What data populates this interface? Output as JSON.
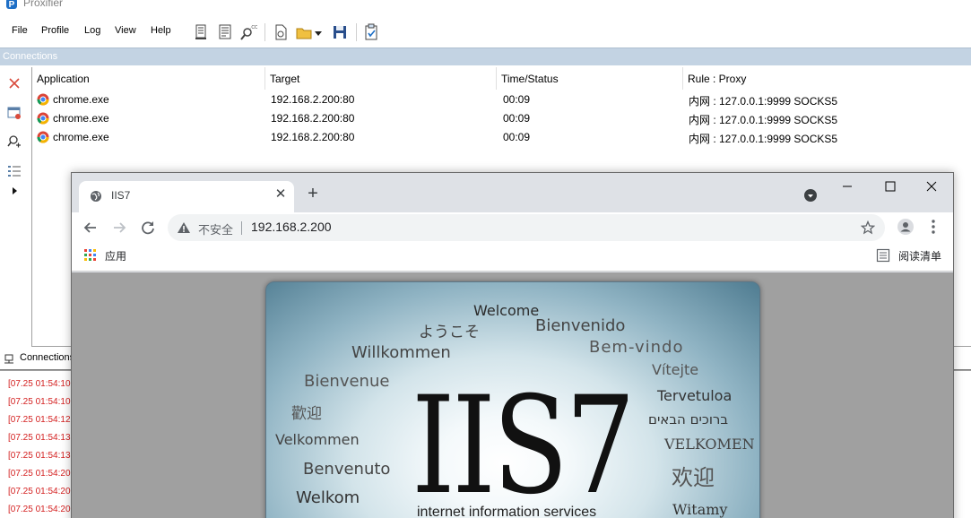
{
  "proxifier": {
    "title": "Proxifier",
    "menu": [
      "File",
      "Profile",
      "Log",
      "View",
      "Help"
    ],
    "toolbar_icons": [
      "proxy-servers-icon",
      "proxification-rules-icon",
      "name-resolution-icon",
      "new-profile-icon",
      "open-profile-icon",
      "save-profile-icon",
      "advanced-settings-icon"
    ],
    "section_label": "Connections",
    "columns": [
      "Application",
      "Target",
      "Time/Status",
      "Rule : Proxy"
    ],
    "connections": [
      {
        "app": "chrome.exe",
        "target": "192.168.2.200:80",
        "time": "00:09",
        "rule": "内网 : 127.0.0.1:9999 SOCKS5"
      },
      {
        "app": "chrome.exe",
        "target": "192.168.2.200:80",
        "time": "00:09",
        "rule": "内网 : 127.0.0.1:9999 SOCKS5"
      },
      {
        "app": "chrome.exe",
        "target": "192.168.2.200:80",
        "time": "00:09",
        "rule": "内网 : 127.0.0.1:9999 SOCKS5"
      }
    ],
    "log_tab": "Connections",
    "log_lines": [
      "[07.25 01:54:10",
      "[07.25 01:54:10",
      "[07.25 01:54:12",
      "[07.25 01:54:13",
      "[07.25 01:54:13",
      "[07.25 01:54:20",
      "[07.25 01:54:20",
      "[07.25 01:54:20"
    ],
    "log_color": "#d42020"
  },
  "chrome": {
    "tab_title": "IIS7",
    "tab_close": "✕",
    "new_tab": "+",
    "security_label": "不安全",
    "url": "192.168.2.200",
    "apps_label": "应用",
    "reading_list": "阅读清单"
  },
  "iis": {
    "logo": "IIS7",
    "subtitle": "internet information services",
    "words": {
      "welcome": "Welcome",
      "jp": "ようこそ",
      "bienvenido": "Bienvenido",
      "willkommen": "Willkommen",
      "bemvindo": "Bem-vindo",
      "vitejte": "Vítejte",
      "bienvenue": "Bienvenue",
      "tervetuloa": "Tervetuloa",
      "zh_tw": "歡迎",
      "he": "ברוכים הבאים",
      "velkommen": "Velkommen",
      "velkomen_caps": "VELKOMEN",
      "benvenuto": "Benvenuto",
      "zh_cn": "欢迎",
      "welkom": "Welkom",
      "witamy": "Witamy"
    }
  }
}
